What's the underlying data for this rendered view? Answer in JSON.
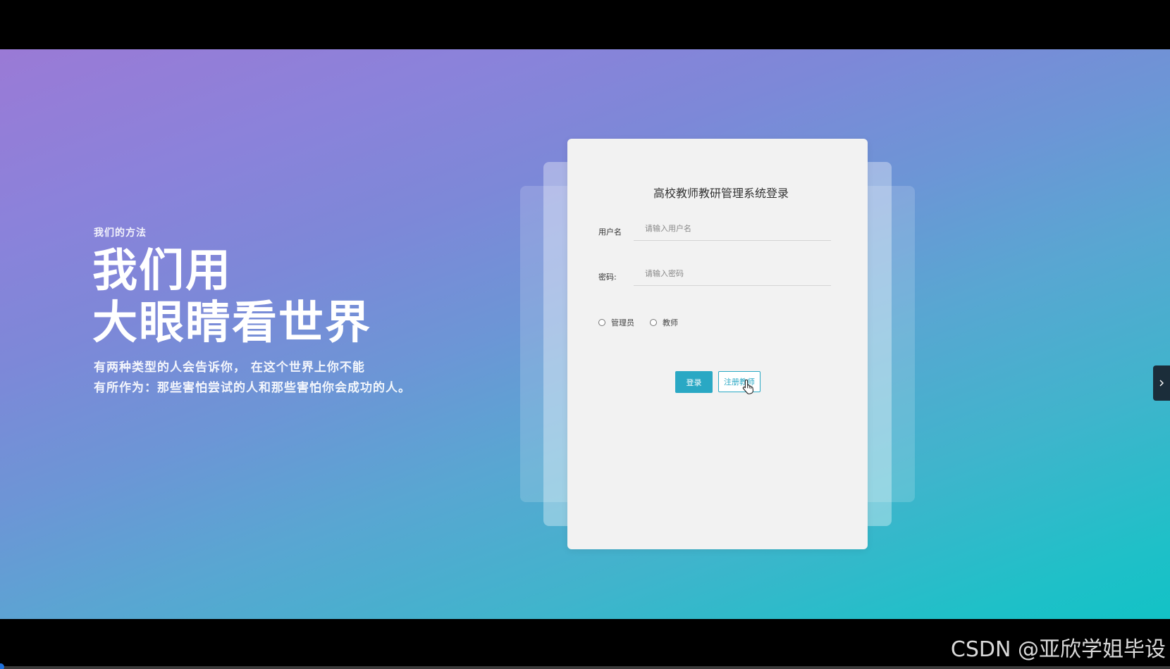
{
  "hero": {
    "kicker": "我们的方法",
    "title_line1": "我们用",
    "title_line2": "大眼睛看世界",
    "desc_line1": "有两种类型的人会告诉你，  在这个世界上你不能",
    "desc_line2": "有所作为：那些害怕尝试的人和那些害怕你会成功的人。"
  },
  "login": {
    "title": "高校教师教研管理系统登录",
    "username_label": "用户名",
    "username_placeholder": "请输入用户名",
    "password_label": "密码:",
    "password_placeholder": "请输入密码",
    "roles": [
      "管理员",
      "教师"
    ],
    "login_button": "登录",
    "register_button": "注册教师"
  },
  "icons": {
    "side_tab": "chevron-right-icon",
    "cursor": "hand-pointer-icon"
  },
  "watermark": "CSDN @亚欣学姐毕设",
  "colors": {
    "accent": "#2aa8c4",
    "gradient_start": "#9a7ad6",
    "gradient_end": "#12c2c6"
  }
}
